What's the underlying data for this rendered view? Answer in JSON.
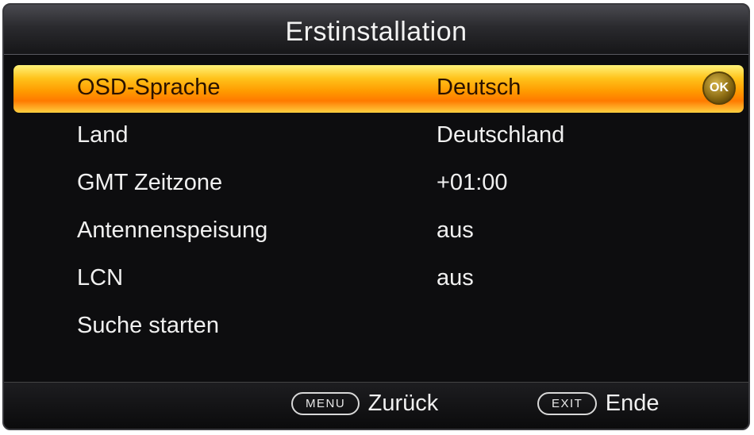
{
  "title": "Erstinstallation",
  "rows": [
    {
      "label": "OSD-Sprache",
      "value": "Deutsch"
    },
    {
      "label": "Land",
      "value": "Deutschland"
    },
    {
      "label": "GMT Zeitzone",
      "value": "+01:00"
    },
    {
      "label": "Antennenspeisung",
      "value": "aus"
    },
    {
      "label": "LCN",
      "value": "aus"
    },
    {
      "label": "Suche starten",
      "value": ""
    }
  ],
  "ok_badge": "OK",
  "footer": {
    "menu_key": "MENU",
    "menu_label": "Zurück",
    "exit_key": "EXIT",
    "exit_label": "Ende"
  },
  "colors": {
    "background": "#0d0d0f",
    "highlight": "#ff9a00",
    "text": "#f0f0f0"
  }
}
